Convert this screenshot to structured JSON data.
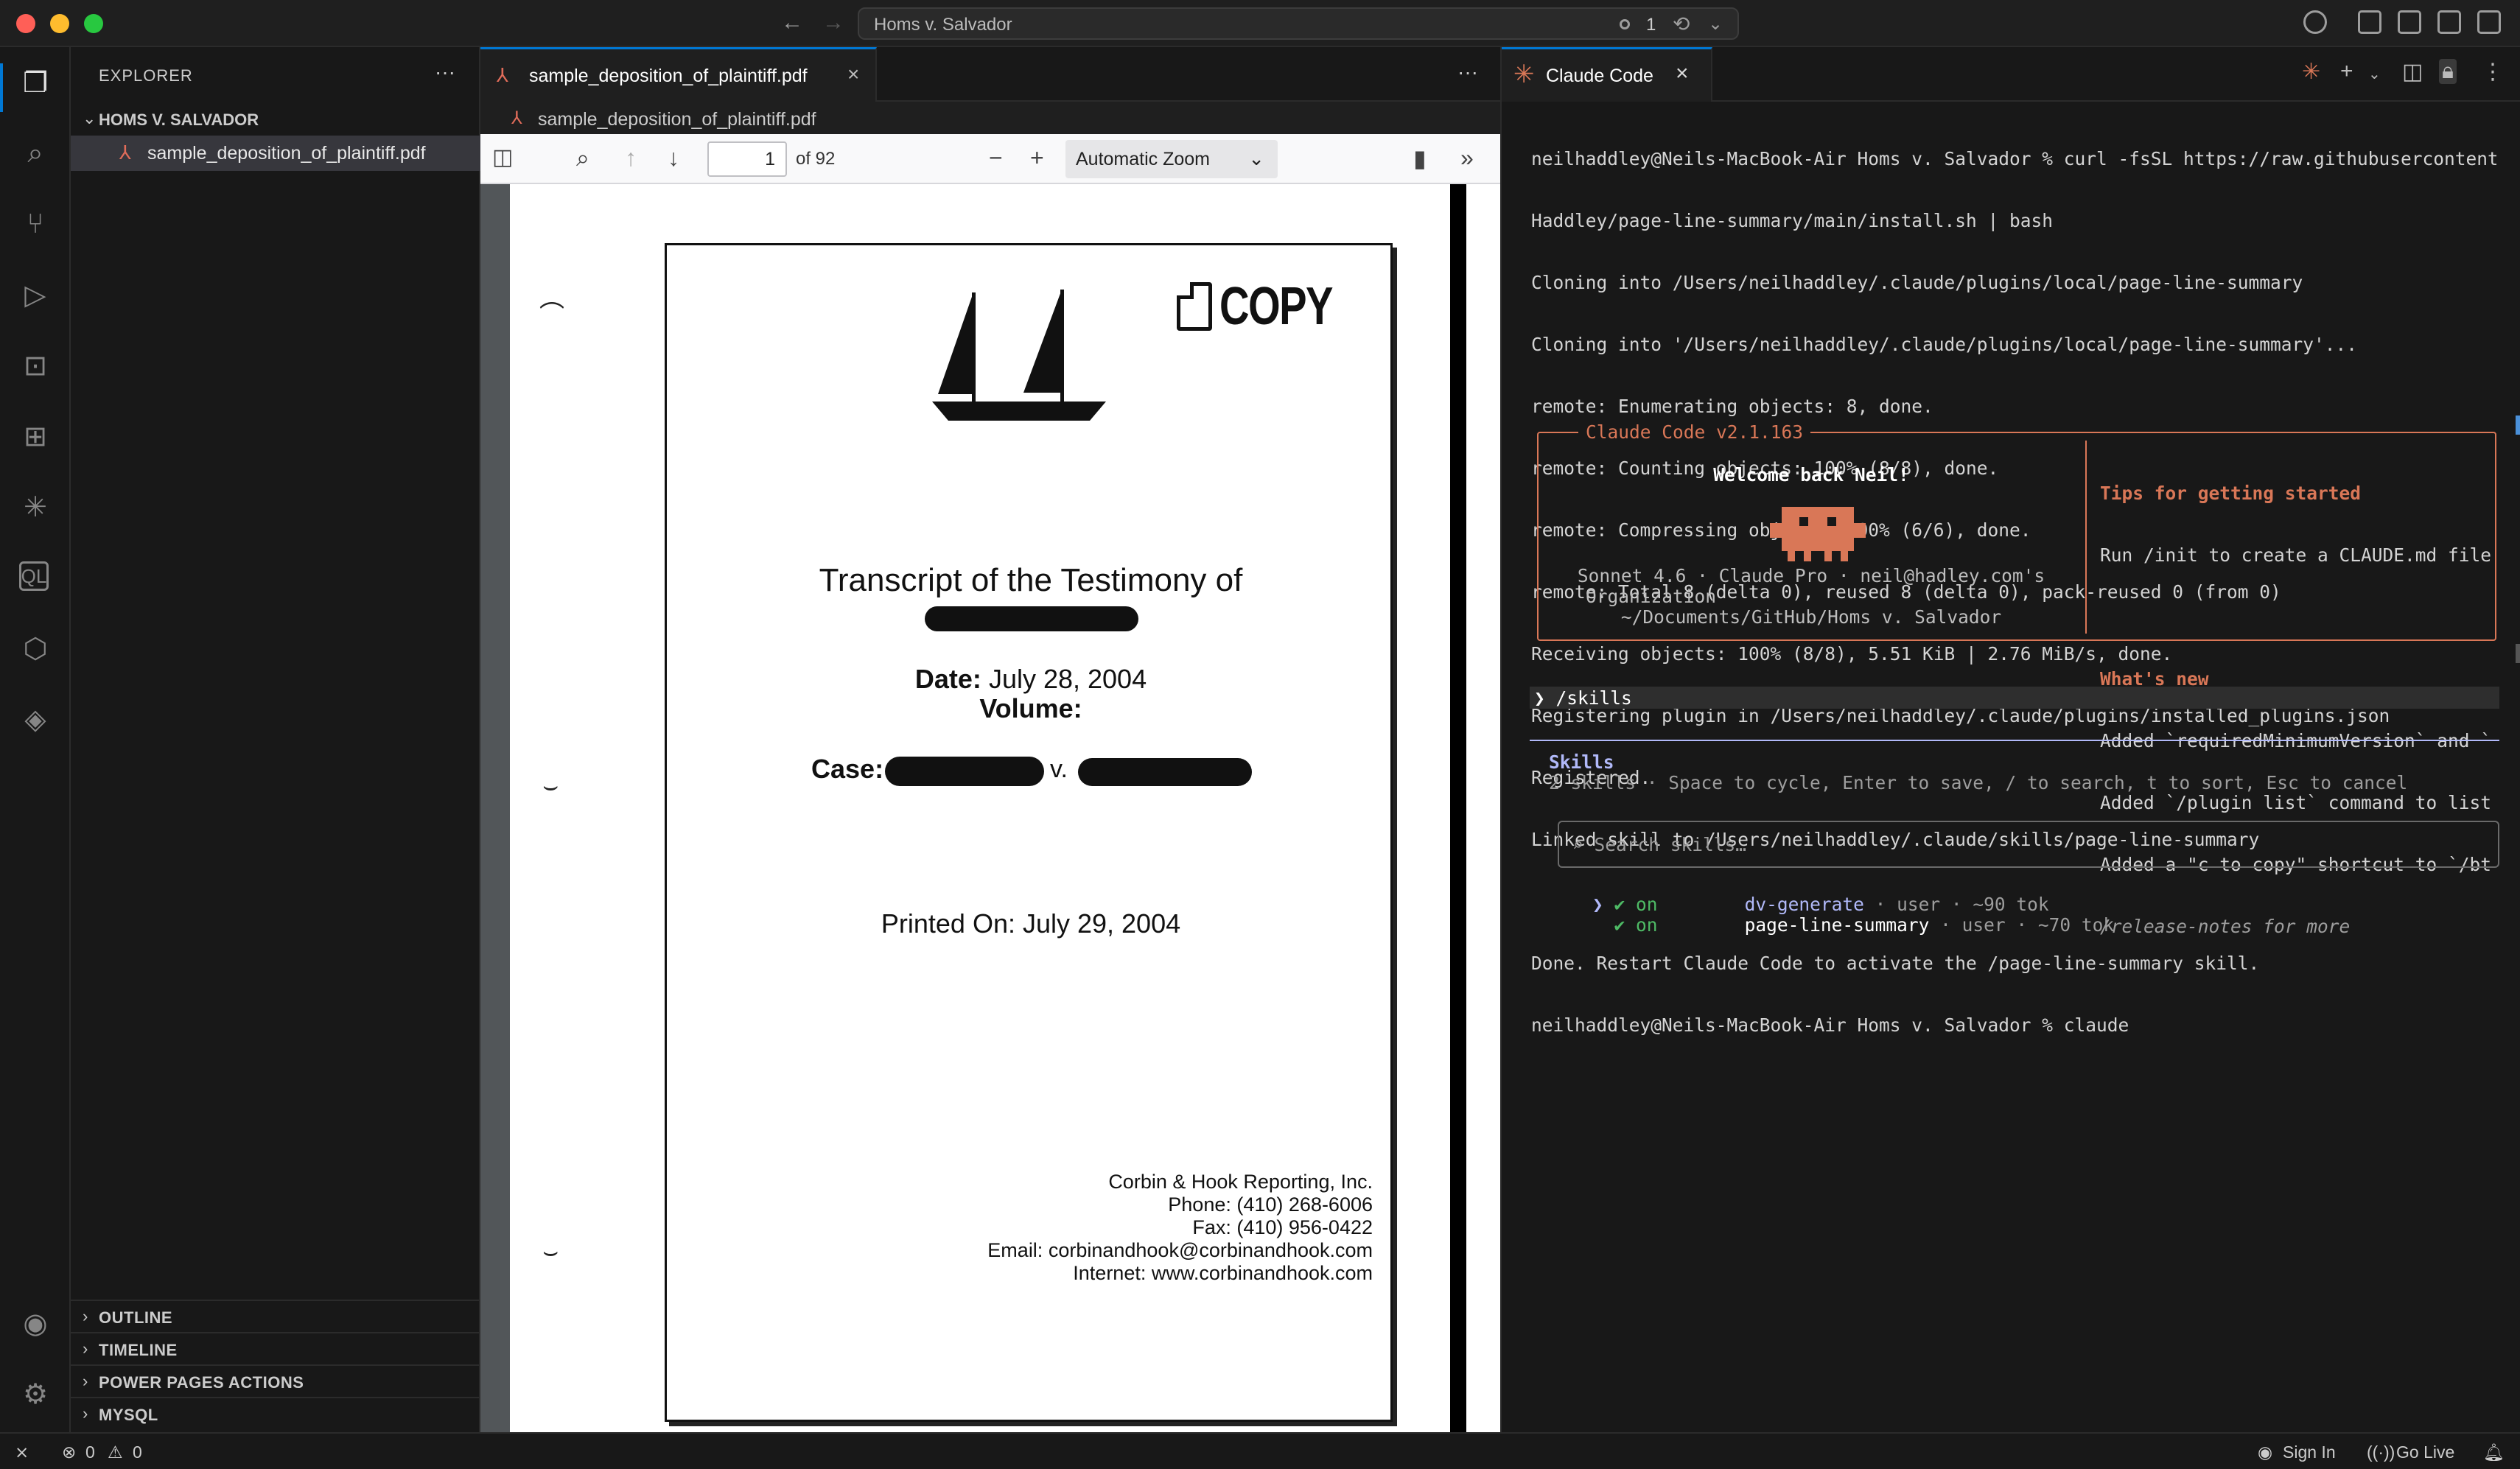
{
  "titlebar": {
    "search_title": "Homs v. Salvador",
    "notification_count": "1"
  },
  "activity_bar": {
    "items": [
      "explorer",
      "search",
      "source-control",
      "run-debug",
      "remote-explorer",
      "extensions",
      "claude",
      "sql",
      "packages",
      "power-platform",
      "accounts",
      "manage"
    ]
  },
  "sidebar": {
    "header": "EXPLORER",
    "folder": "HOMS V. SALVADOR",
    "file": "sample_deposition_of_plaintiff.pdf",
    "sections": [
      "OUTLINE",
      "TIMELINE",
      "POWER PAGES ACTIONS",
      "MYSQL"
    ]
  },
  "editor": {
    "tab_label": "sample_deposition_of_plaintiff.pdf",
    "breadcrumb": "sample_deposition_of_plaintiff.pdf"
  },
  "pdf": {
    "page_number": "1",
    "page_total": "of 92",
    "zoom": "Automatic Zoom",
    "stamp": "COPY",
    "title": "Transcript of the Testimony of",
    "date_label": "Date:",
    "date_value": " July 28, 2004",
    "volume_label": "Volume:",
    "case_label": "Case:",
    "case_v": "v.",
    "printed": "Printed On: July 29, 2004",
    "contact_lines": [
      "Corbin & Hook Reporting, Inc.",
      "Phone: (410) 268-6006",
      "Fax: (410) 956-0422",
      "Email: corbinandhook@corbinandhook.com",
      "Internet: www.corbinandhook.com"
    ]
  },
  "terminal": {
    "tab_label": "Claude Code",
    "lines": [
      "neilhaddley@Neils-MacBook-Air Homs v. Salvador % curl -fsSL https://raw.githubusercontent.com/",
      "Haddley/page-line-summary/main/install.sh | bash",
      "Cloning into /Users/neilhaddley/.claude/plugins/local/page-line-summary",
      "Cloning into '/Users/neilhaddley/.claude/plugins/local/page-line-summary'...",
      "remote: Enumerating objects: 8, done.",
      "remote: Counting objects: 100% (8/8), done.",
      "remote: Compressing objects: 100% (6/6), done.",
      "remote: Total 8 (delta 0), reused 8 (delta 0), pack-reused 0 (from 0)",
      "Receiving objects: 100% (8/8), 5.51 KiB | 2.76 MiB/s, done.",
      "Registering plugin in /Users/neilhaddley/.claude/plugins/installed_plugins.json",
      "Registered.",
      "Linked skill to /Users/neilhaddley/.claude/skills/page-line-summary",
      "",
      "Done. Restart Claude Code to activate the /page-line-summary skill.",
      "neilhaddley@Neils-MacBook-Air Homs v. Salvador % claude"
    ],
    "welcome": {
      "legend": "Claude Code v2.1.163",
      "greeting": "Welcome back Neil!",
      "info_lines": [
        "Sonnet 4.6 · Claude Pro · neil@hadley.com's",
        "Organization",
        "~/Documents/GitHub/Homs v. Salvador"
      ],
      "tips_header": "Tips for getting started",
      "tips_line": "Run /init to create a CLAUDE.md file…",
      "news_header": "What's new",
      "news_lines": [
        "Added `requiredMinimumVersion` and `…",
        "Added `/plugin list` command to list…",
        "Added a \"c to copy\" shortcut to `/bt…"
      ],
      "release_notes": "/release-notes for more"
    },
    "prompt": "❯ /skills",
    "skills_title": "Skills",
    "skills_sub": "2 skills · Space to cycle, Enter to save, / to search, t to sort, Esc to cancel",
    "search_placeholder": "⌕ Search skills…",
    "skills": [
      {
        "caret": "❯",
        "status": "✔ on",
        "name": "dv-generate",
        "meta": " · user · ~90 tok"
      },
      {
        "caret": " ",
        "status": "✔ on",
        "name": "page-line-summary",
        "meta": " · user · ~70 tok"
      }
    ]
  },
  "statusbar": {
    "errors": "0",
    "warnings": "0",
    "sign_in": "Sign In",
    "go_live": "Go Live"
  },
  "colors": {
    "accent": "#0078d4",
    "claude": "#d97757",
    "skills": "#b1b9f9",
    "ok": "#4eba65"
  }
}
